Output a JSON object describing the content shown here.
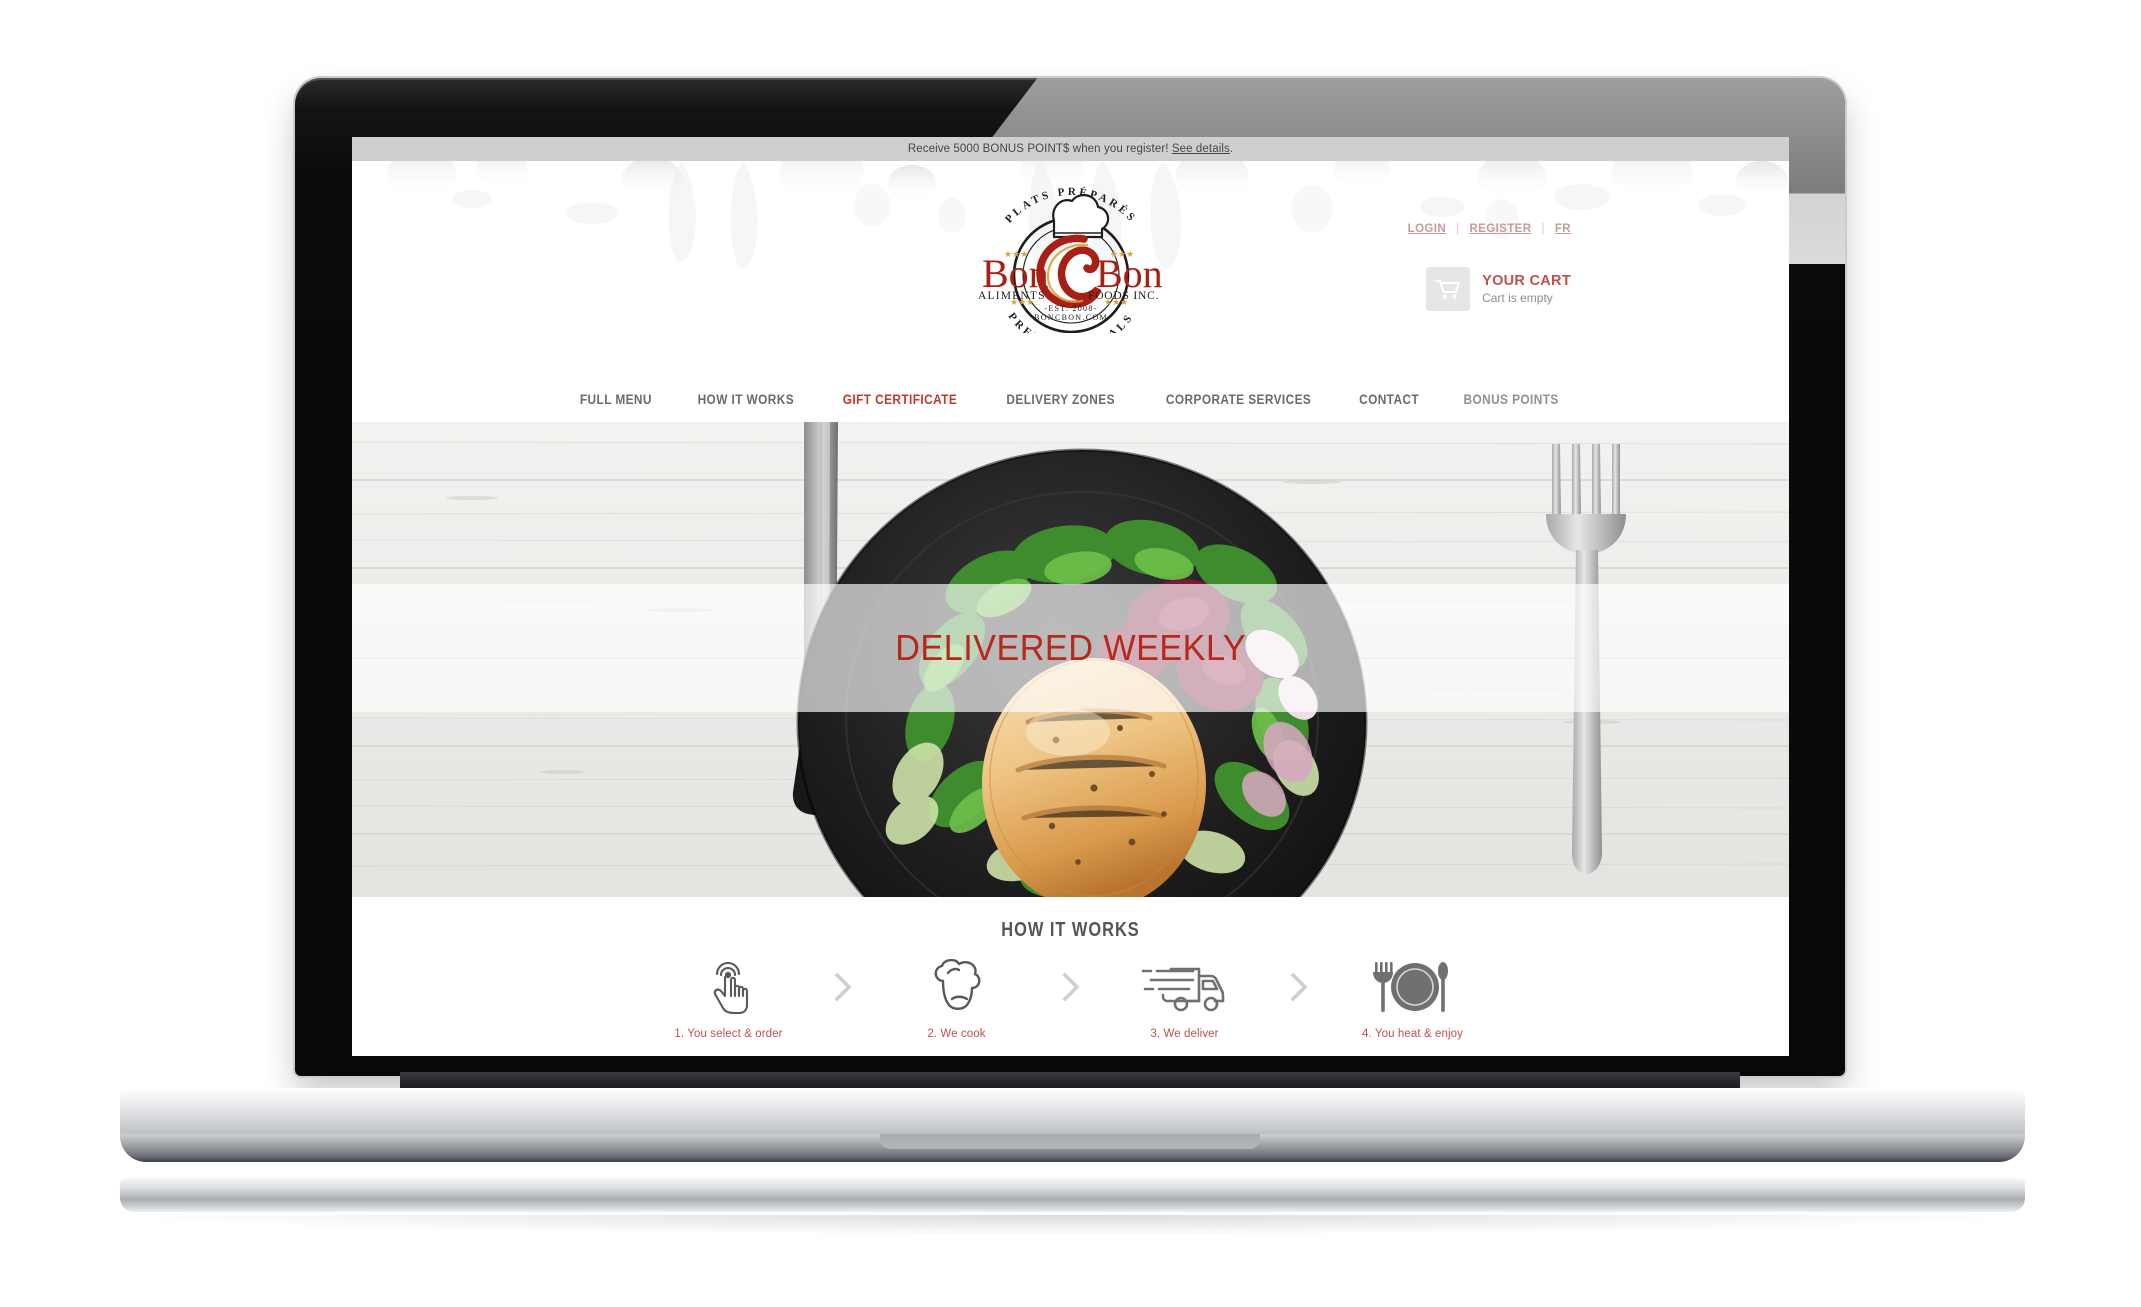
{
  "promo": {
    "text": "Receive 5000 BONUS POINT$ when you register! ",
    "link_label": "See details",
    "period": "."
  },
  "header": {
    "utility_links": [
      {
        "label": "LOGIN"
      },
      {
        "label": "REGISTER"
      },
      {
        "label": "FR"
      }
    ],
    "separator": "|",
    "cart": {
      "title": "YOUR CART",
      "status": "Cart is empty",
      "icon": "shopping-cart-icon"
    },
    "logo": {
      "word_left": "Bon",
      "word_center": "C",
      "word_right": "Bon",
      "sub_left": "ALIMENTS",
      "sub_right": "FOODS INC.",
      "arc_top": "PLATS   PRÉPARÉS",
      "arc_bottom": "PREPARED MEALS",
      "est_line": "-EST. 2008-",
      "domain_line": "BONCBON.COM"
    }
  },
  "nav": {
    "items": [
      {
        "label": "FULL MENU",
        "state": "default"
      },
      {
        "label": "HOW IT WORKS",
        "state": "default"
      },
      {
        "label": "GIFT CERTIFICATE",
        "state": "active"
      },
      {
        "label": "DELIVERY ZONES",
        "state": "default"
      },
      {
        "label": "CORPORATE SERVICES",
        "state": "default"
      },
      {
        "label": "CONTACT",
        "state": "default"
      },
      {
        "label": "BONUS POINTS",
        "state": "muted"
      }
    ]
  },
  "hero": {
    "headline": "DELIVERED WEEKLY"
  },
  "how_it_works": {
    "title": "HOW IT WORKS",
    "chevron": "›",
    "steps": [
      {
        "label": "1. You select & order",
        "icon": "tap-hand-icon"
      },
      {
        "label": "2. We cook",
        "icon": "chef-hat-icon"
      },
      {
        "label": "3. We deliver",
        "icon": "delivery-truck-icon"
      },
      {
        "label": "4. You heat & enjoy",
        "icon": "plate-cutlery-icon"
      }
    ]
  },
  "colors": {
    "brand_red": "#c0392b",
    "logo_red": "#a82015",
    "hero_red": "#b5291c",
    "nav_grey": "#6e6a67",
    "promo_bar": "#cfcfcf",
    "cart_red": "#c0504d"
  }
}
